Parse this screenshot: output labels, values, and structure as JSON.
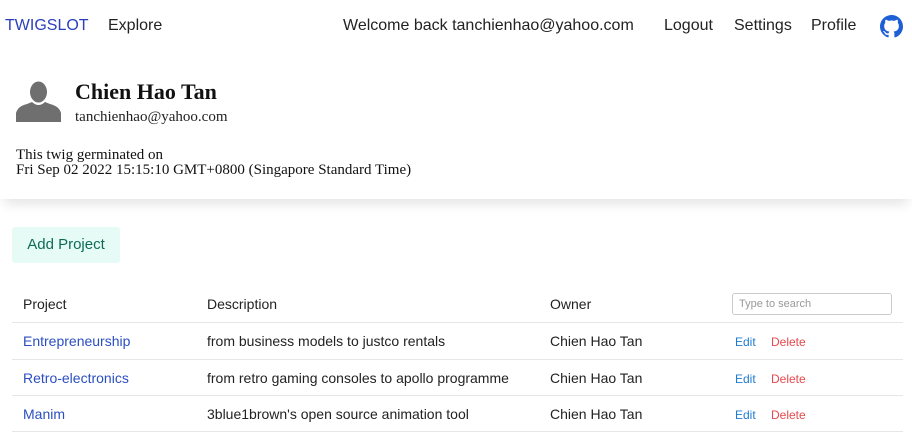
{
  "nav": {
    "brand": "TWIGSLOT",
    "explore": "Explore",
    "welcome": "Welcome back tanchienhao@yahoo.com",
    "logout": "Logout",
    "settings": "Settings",
    "profile": "Profile",
    "github_icon": "github-icon"
  },
  "user": {
    "name": "Chien Hao Tan",
    "email": "tanchienhao@yahoo.com",
    "germinated_label": "This twig germinated on",
    "germinated_date": "Fri Sep 02 2022 15:15:10 GMT+0800 (Singapore Standard Time)",
    "avatar_icon": "user-silhouette-icon"
  },
  "add_project_label": "Add Project",
  "table": {
    "headers": {
      "project": "Project",
      "description": "Description",
      "owner": "Owner"
    },
    "search_placeholder": "Type to search",
    "edit_label": "Edit",
    "delete_label": "Delete",
    "rows": [
      {
        "project": "Entrepreneurship",
        "description": "from business models to justco rentals",
        "owner": "Chien Hao Tan"
      },
      {
        "project": "Retro-electronics",
        "description": "from retro gaming consoles to apollo programme",
        "owner": "Chien Hao Tan"
      },
      {
        "project": "Manim",
        "description": "3blue1brown's open source animation tool",
        "owner": "Chien Hao Tan"
      }
    ]
  },
  "colors": {
    "brand": "#2b3fbb",
    "link": "#2b4fbf",
    "edit": "#1e7bd0",
    "delete": "#e5484d",
    "add_button_bg": "#e6fbf6",
    "add_button_text": "#0f6b57"
  }
}
